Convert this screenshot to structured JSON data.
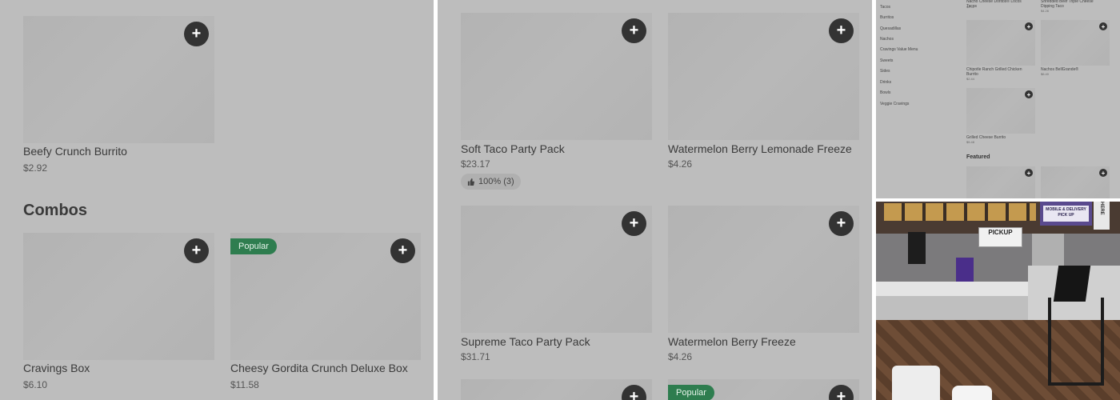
{
  "panel1": {
    "top_item": {
      "name": "Beefy Crunch Burrito",
      "price": "$2.92"
    },
    "section_title": "Combos",
    "combos": [
      {
        "name": "Cravings Box",
        "price": "$6.10",
        "badge": ""
      },
      {
        "name": "Cheesy Gordita Crunch Deluxe Box",
        "price": "$11.58",
        "badge": "Popular"
      }
    ]
  },
  "panel2": {
    "items": [
      {
        "name": "Soft Taco Party Pack",
        "price": "$23.17",
        "rating": "100% (3)"
      },
      {
        "name": "Watermelon Berry Lemonade Freeze",
        "price": "$4.26"
      },
      {
        "name": "Supreme Taco Party Pack",
        "price": "$31.71"
      },
      {
        "name": "Watermelon Berry Freeze",
        "price": "$4.26"
      }
    ],
    "bottom_badge": "Popular"
  },
  "panel3": {
    "nav": [
      "Tacos",
      "Burritos",
      "Quesadillas",
      "Nachos",
      "Cravings Value Menu",
      "Sweets",
      "Sides",
      "Drinks",
      "Bowls",
      "Veggie Cravings"
    ],
    "top_items": [
      {
        "name": "Nacho Cheese Doritos® Locos Tacos",
        "price": "$2.92"
      },
      {
        "name": "Shredded Beef Triple Cheese Dipping Taco",
        "price": "$4.26"
      }
    ],
    "items": [
      {
        "name": "Chipotle Ranch Grilled Chicken Burrito",
        "price": "$2.44"
      },
      {
        "name": "Nachos BellGrande®",
        "price": "$6.40"
      },
      {
        "name": "Grilled Cheese Burrito",
        "price": "$5.48"
      }
    ],
    "featured_title": "Featured"
  },
  "panel4": {
    "sign_top": "MOBILE & DELIVERY",
    "sign_sub": "PICK UP",
    "sign_main": "PICKUP",
    "vertical_sign": "HERE"
  },
  "icons": {
    "add": "plus-icon",
    "like": "thumbs-up-icon"
  },
  "colors": {
    "badge": "#2e7d4f",
    "add_button": "#333333",
    "panel_bg": "#bdbdbd"
  }
}
